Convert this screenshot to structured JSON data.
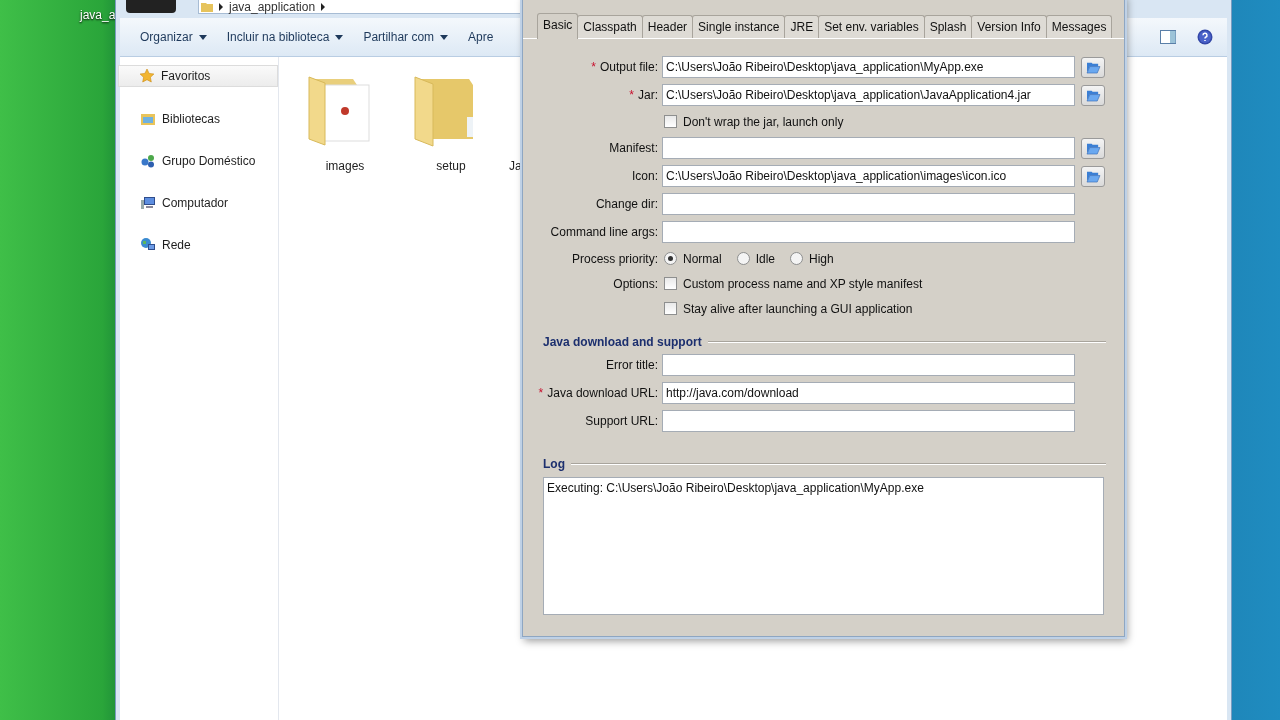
{
  "desktop": {
    "icon_label": "java_a"
  },
  "explorer": {
    "breadcrumb": [
      "java_application"
    ],
    "toolbar": [
      {
        "label": "Organizar",
        "dropdown": true
      },
      {
        "label": "Incluir na biblioteca",
        "dropdown": true
      },
      {
        "label": "Partilhar com",
        "dropdown": true
      },
      {
        "label": "Apre",
        "dropdown": false
      }
    ],
    "sidebar": [
      {
        "label": "Favoritos",
        "kind": "star",
        "selected": true
      },
      {
        "label": "Bibliotecas",
        "kind": "library",
        "selected": false
      },
      {
        "label": "Grupo Doméstico",
        "kind": "homegroup",
        "selected": false
      },
      {
        "label": "Computador",
        "kind": "computer",
        "selected": false
      },
      {
        "label": "Rede",
        "kind": "network",
        "selected": false
      }
    ],
    "items": [
      {
        "name": "images",
        "kind": "document-folder"
      },
      {
        "name": "setup",
        "kind": "folder"
      },
      {
        "name": "Ja",
        "kind": "cut"
      }
    ]
  },
  "dialog": {
    "tabs": [
      {
        "label": "Basic",
        "selected": true
      },
      {
        "label": "Classpath",
        "selected": false
      },
      {
        "label": "Header",
        "selected": false
      },
      {
        "label": "Single instance",
        "selected": false
      },
      {
        "label": "JRE",
        "selected": false
      },
      {
        "label": "Set env. variables",
        "selected": false
      },
      {
        "label": "Splash",
        "selected": false
      },
      {
        "label": "Version Info",
        "selected": false
      },
      {
        "label": "Messages",
        "selected": false
      }
    ],
    "rows": [
      {
        "kind": "field",
        "label": "Output file:",
        "required_mark": "*",
        "value": "C:\\Users\\João Ribeiro\\Desktop\\java_application\\MyApp.exe",
        "browse": true
      },
      {
        "kind": "field",
        "label": "Jar:",
        "required_mark": "*",
        "value": "C:\\Users\\João Ribeiro\\Desktop\\java_application\\JavaApplication4.jar",
        "browse": true
      },
      {
        "kind": "checkbox",
        "text": "Don't wrap the jar, launch only",
        "checked": false
      },
      {
        "kind": "field",
        "label": "Manifest:",
        "browse": true
      },
      {
        "kind": "field",
        "label": "Icon:",
        "value": "C:\\Users\\João Ribeiro\\Desktop\\java_application\\images\\icon.ico",
        "browse": true
      },
      {
        "kind": "field",
        "label": "Change dir:",
        "browse": false
      },
      {
        "kind": "field",
        "label": "Command line args:",
        "browse": false
      },
      {
        "kind": "radio",
        "label": "Process priority:",
        "options": [
          {
            "label": "Normal",
            "selected": true
          },
          {
            "label": "Idle",
            "selected": false
          },
          {
            "label": "High",
            "selected": false
          }
        ]
      },
      {
        "kind": "checkbox",
        "label": "Options:",
        "text": "Custom process name and XP style manifest",
        "checked": false
      },
      {
        "kind": "checkbox",
        "text": "Stay alive after launching a GUI application",
        "checked": false
      }
    ],
    "section": {
      "title": "Java download and support",
      "rows": [
        {
          "kind": "field",
          "label": "Error title:",
          "browse": false
        },
        {
          "kind": "field",
          "label": "Java download URL:",
          "required_mark": "*",
          "value": "http://java.com/download",
          "browse": false
        },
        {
          "kind": "field",
          "label": "Support URL:",
          "browse": false
        }
      ]
    },
    "log": {
      "title": "Log",
      "text": "Executing: C:\\Users\\João Ribeiro\\Desktop\\java_application\\MyApp.exe"
    }
  }
}
